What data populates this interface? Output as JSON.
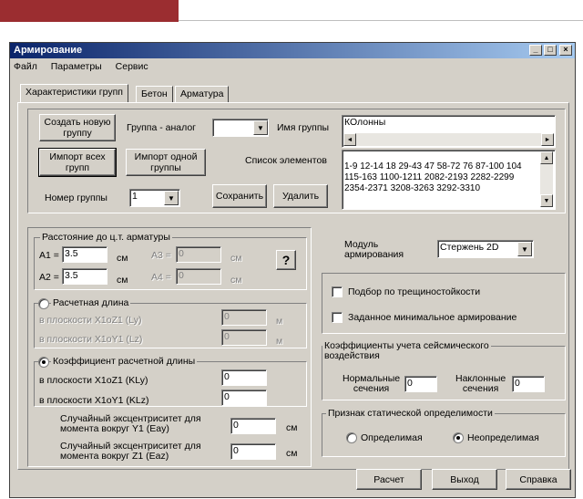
{
  "window": {
    "title": "Армирование",
    "controls": [
      "_",
      "□",
      "×"
    ]
  },
  "menu": [
    "Файл",
    "Параметры",
    "Сервис"
  ],
  "tabs": [
    "Характеристики групп",
    "Бетон",
    "Арматура"
  ],
  "groups_panel": {
    "create_btn": "Создать новую группу",
    "import_all_btn": "Импорт всех групп",
    "import_one_btn": "Импорт одной группы",
    "analog_label": "Группа - аналог",
    "analog_value": "",
    "name_label": "Имя группы",
    "name_value": "КОлонны",
    "elements_label": "Список элементов",
    "elements_value": "1-9 12-14 18 29-43 47 58-72 76 87-100 104\n115-163 1100-1211 2082-2193 2282-2299\n2354-2371 3208-3263 3292-3310",
    "number_label": "Номер группы",
    "number_value": "1",
    "save_btn": "Сохранить",
    "delete_btn": "Удалить"
  },
  "distance": {
    "legend": "Расстояние до ц.т. арматуры",
    "a1_label": "A1 =",
    "a1_value": "3.5",
    "a2_label": "A2 =",
    "a2_value": "3.5",
    "a3_label": "A3 =",
    "a3_value": "0",
    "a4_label": "A4 =",
    "a4_value": "0",
    "unit": "см",
    "help_btn": "?"
  },
  "calc_length": {
    "legend": "Расчетная длина",
    "ly_label": "в плоскости X1oZ1  (Ly)",
    "ly_value": "0",
    "lz_label": "в плоскости X1oY1  (Lz)",
    "lz_value": "0",
    "unit": "м"
  },
  "coef": {
    "legend": "Коэффициент расчетной длины",
    "kly_label": "в плоскости X1oZ1  (KLy)",
    "kly_value": "0",
    "klz_label": "в плоскости X1oY1  (KLz)",
    "klz_value": "0"
  },
  "eccentricity": {
    "eay_label": "Случайный эксцентриситет для\nмомента вокруг Y1  (Eay)",
    "eay_value": "0",
    "eaz_label": "Случайный эксцентриситет для\nмомента вокруг Z1  (Eaz)",
    "eaz_value": "0",
    "unit": "см"
  },
  "module": {
    "label": "Модуль\nармирования",
    "value": "Стержень 2D"
  },
  "checks": {
    "crack": "Подбор по трещиностойкости",
    "min_reinf": "Заданное минимальное армирование"
  },
  "seismic": {
    "legend": "Коэффициенты учета сейсмического\nвоздействия",
    "normal_label": "Нормальные\nсечения",
    "normal_value": "0",
    "inclined_label": "Наклонные\nсечения",
    "inclined_value": "0"
  },
  "static": {
    "legend": "Признак статической определимости",
    "determinate": "Определимая",
    "indeterminate": "Неопределимая"
  },
  "footer": {
    "calc_btn": "Расчет",
    "exit_btn": "Выход",
    "help_btn": "Справка"
  },
  "colors": {
    "brand_bar": "#9b2d30",
    "titlebar_start": "#0a246a",
    "titlebar_end": "#a6caf0",
    "face": "#d4d0c8"
  }
}
